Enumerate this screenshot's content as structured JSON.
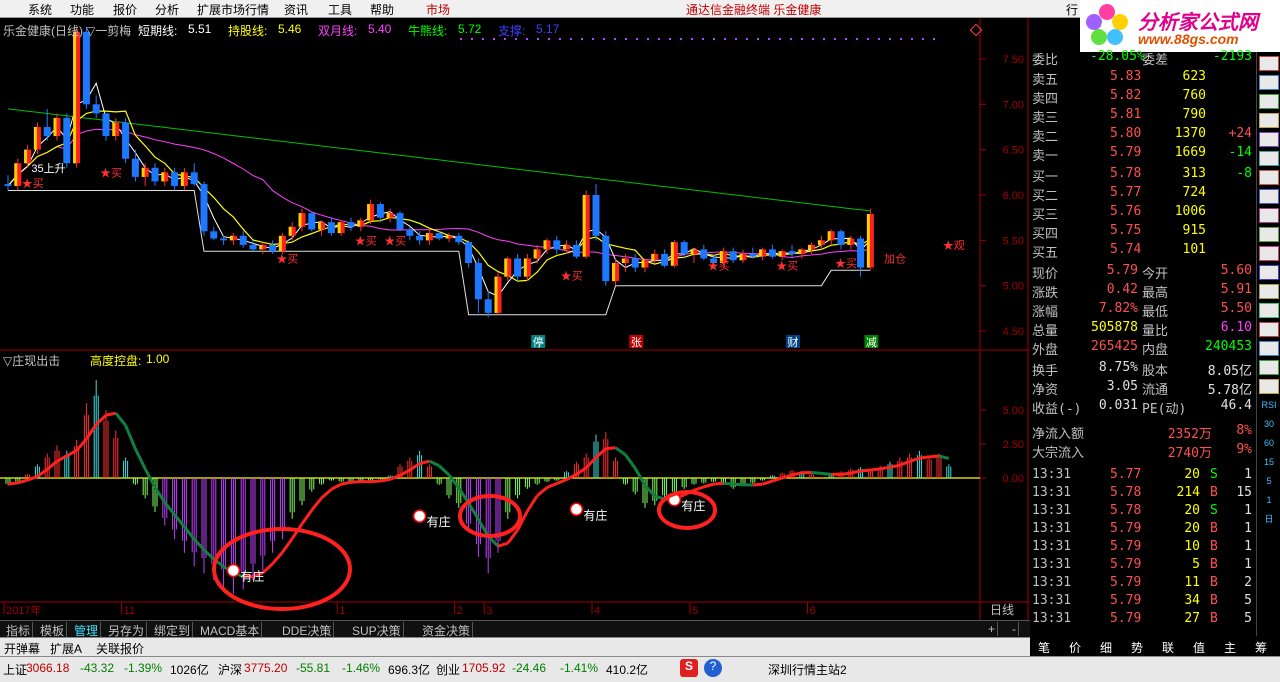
{
  "menu": [
    "系统",
    "功能",
    "报价",
    "分析",
    "扩展市场行情",
    "资讯",
    "工具",
    "帮助",
    "市场"
  ],
  "center_title": "通达信金融终端  乐金健康",
  "right_menu": "行",
  "logo": {
    "text1": "分析家公式网",
    "text2": "www.88gs.com"
  },
  "chart_header": {
    "name": "乐金健康(日线)",
    "indicator": "▽一剪梅",
    "items": [
      {
        "label": "短期线:",
        "value": "5.51",
        "color": "#ffffff"
      },
      {
        "label": "持股线:",
        "value": "5.46",
        "color": "#ffff00"
      },
      {
        "label": "双月线:",
        "value": "5.40",
        "color": "#ff40ff"
      },
      {
        "label": "牛熊线:",
        "value": "5.72",
        "color": "#00ff00"
      },
      {
        "label": "支撑:",
        "value": "5.17",
        "color": "#4040ff"
      }
    ]
  },
  "price_axis": [
    "7.50",
    "7.00",
    "6.50",
    "6.00",
    "5.50",
    "5.00",
    "4.50"
  ],
  "candles": [
    [
      6.12,
      6.22,
      6.05,
      6.1
    ],
    [
      6.1,
      6.4,
      6.05,
      6.35
    ],
    [
      6.35,
      6.55,
      6.3,
      6.5
    ],
    [
      6.5,
      6.8,
      6.45,
      6.75
    ],
    [
      6.75,
      6.95,
      6.6,
      6.65
    ],
    [
      6.65,
      6.9,
      6.6,
      6.85
    ],
    [
      6.85,
      6.9,
      6.3,
      6.35
    ],
    [
      6.35,
      7.85,
      6.3,
      7.8
    ],
    [
      7.8,
      7.85,
      6.95,
      7.0
    ],
    [
      7.0,
      7.1,
      6.85,
      6.9
    ],
    [
      6.9,
      6.9,
      6.6,
      6.65
    ],
    [
      6.65,
      6.85,
      6.6,
      6.8
    ],
    [
      6.8,
      6.85,
      6.35,
      6.4
    ],
    [
      6.4,
      6.5,
      6.15,
      6.2
    ],
    [
      6.2,
      6.35,
      6.1,
      6.3
    ],
    [
      6.3,
      6.35,
      6.1,
      6.15
    ],
    [
      6.15,
      6.3,
      6.1,
      6.25
    ],
    [
      6.25,
      6.3,
      6.05,
      6.1
    ],
    [
      6.1,
      6.3,
      6.05,
      6.25
    ],
    [
      6.25,
      6.35,
      6.1,
      6.12
    ],
    [
      6.12,
      6.15,
      5.55,
      5.6
    ],
    [
      5.6,
      5.65,
      5.5,
      5.52
    ],
    [
      5.52,
      5.55,
      5.45,
      5.5
    ],
    [
      5.5,
      5.58,
      5.45,
      5.55
    ],
    [
      5.55,
      5.6,
      5.42,
      5.45
    ],
    [
      5.45,
      5.5,
      5.38,
      5.4
    ],
    [
      5.4,
      5.48,
      5.35,
      5.45
    ],
    [
      5.45,
      5.5,
      5.35,
      5.38
    ],
    [
      5.38,
      5.58,
      5.35,
      5.55
    ],
    [
      5.55,
      5.7,
      5.5,
      5.65
    ],
    [
      5.65,
      5.85,
      5.6,
      5.8
    ],
    [
      5.8,
      5.82,
      5.6,
      5.62
    ],
    [
      5.62,
      5.72,
      5.55,
      5.7
    ],
    [
      5.7,
      5.75,
      5.55,
      5.58
    ],
    [
      5.58,
      5.72,
      5.55,
      5.7
    ],
    [
      5.7,
      5.75,
      5.6,
      5.65
    ],
    [
      5.65,
      5.75,
      5.6,
      5.72
    ],
    [
      5.72,
      5.95,
      5.68,
      5.9
    ],
    [
      5.9,
      5.92,
      5.7,
      5.75
    ],
    [
      5.75,
      5.85,
      5.7,
      5.8
    ],
    [
      5.8,
      5.82,
      5.6,
      5.62
    ],
    [
      5.62,
      5.65,
      5.5,
      5.55
    ],
    [
      5.55,
      5.6,
      5.45,
      5.5
    ],
    [
      5.5,
      5.62,
      5.45,
      5.58
    ],
    [
      5.58,
      5.6,
      5.5,
      5.52
    ],
    [
      5.52,
      5.58,
      5.48,
      5.55
    ],
    [
      5.55,
      5.58,
      5.45,
      5.48
    ],
    [
      5.48,
      5.5,
      5.2,
      5.25
    ],
    [
      5.25,
      5.3,
      4.7,
      4.85
    ],
    [
      4.85,
      4.95,
      4.65,
      4.7
    ],
    [
      4.7,
      5.15,
      4.68,
      5.1
    ],
    [
      5.1,
      5.32,
      5.05,
      5.3
    ],
    [
      5.3,
      5.35,
      5.05,
      5.1
    ],
    [
      5.1,
      5.35,
      5.05,
      5.3
    ],
    [
      5.3,
      5.45,
      5.25,
      5.4
    ],
    [
      5.4,
      5.52,
      5.35,
      5.5
    ],
    [
      5.5,
      5.55,
      5.35,
      5.4
    ],
    [
      5.4,
      5.5,
      5.35,
      5.45
    ],
    [
      5.45,
      5.5,
      5.3,
      5.32
    ],
    [
      5.32,
      6.05,
      5.3,
      6.0
    ],
    [
      6.0,
      6.12,
      5.5,
      5.55
    ],
    [
      5.55,
      5.6,
      5.0,
      5.05
    ],
    [
      5.05,
      5.3,
      5.0,
      5.25
    ],
    [
      5.25,
      5.35,
      5.15,
      5.3
    ],
    [
      5.3,
      5.35,
      5.15,
      5.2
    ],
    [
      5.2,
      5.3,
      5.15,
      5.28
    ],
    [
      5.28,
      5.4,
      5.25,
      5.35
    ],
    [
      5.35,
      5.4,
      5.2,
      5.22
    ],
    [
      5.22,
      5.5,
      5.2,
      5.48
    ],
    [
      5.48,
      5.5,
      5.3,
      5.35
    ],
    [
      5.35,
      5.42,
      5.25,
      5.4
    ],
    [
      5.4,
      5.45,
      5.28,
      5.3
    ],
    [
      5.3,
      5.35,
      5.2,
      5.25
    ],
    [
      5.25,
      5.42,
      5.22,
      5.38
    ],
    [
      5.38,
      5.42,
      5.25,
      5.28
    ],
    [
      5.28,
      5.4,
      5.25,
      5.35
    ],
    [
      5.35,
      5.42,
      5.3,
      5.32
    ],
    [
      5.32,
      5.42,
      5.28,
      5.4
    ],
    [
      5.4,
      5.45,
      5.3,
      5.32
    ],
    [
      5.32,
      5.4,
      5.28,
      5.38
    ],
    [
      5.38,
      5.45,
      5.3,
      5.35
    ],
    [
      5.35,
      5.42,
      5.3,
      5.4
    ],
    [
      5.4,
      5.48,
      5.35,
      5.45
    ],
    [
      5.45,
      5.55,
      5.4,
      5.5
    ],
    [
      5.5,
      5.62,
      5.45,
      5.6
    ],
    [
      5.6,
      5.62,
      5.4,
      5.45
    ],
    [
      5.45,
      5.55,
      5.4,
      5.52
    ],
    [
      5.52,
      5.55,
      5.1,
      5.2
    ],
    [
      5.2,
      5.85,
      5.18,
      5.79
    ]
  ],
  "ma_note": "",
  "price_annotations": [
    {
      "text": "35上升",
      "color": "#ffffff",
      "bar": 3,
      "price": 6.3
    },
    {
      "text": "★买",
      "color": "#ff3030",
      "bar": 2,
      "price": 6.13
    },
    {
      "text": "★买",
      "color": "#ff3030",
      "bar": 10,
      "price": 6.25
    },
    {
      "text": "★买",
      "color": "#ff3030",
      "bar": 36,
      "price": 5.5
    },
    {
      "text": "★买",
      "color": "#ff3030",
      "bar": 39,
      "price": 5.5
    },
    {
      "text": "★买",
      "color": "#ff3030",
      "bar": 28,
      "price": 5.3
    },
    {
      "text": "★买",
      "color": "#ff3030",
      "bar": 57,
      "price": 5.11
    },
    {
      "text": "★买",
      "color": "#ff3030",
      "bar": 72,
      "price": 5.22
    },
    {
      "text": "★买",
      "color": "#ff3030",
      "bar": 79,
      "price": 5.22
    },
    {
      "text": "★买",
      "color": "#ff3030",
      "bar": 85,
      "price": 5.25
    },
    {
      "text": "加仓",
      "color": "#ff3030",
      "bar": 90,
      "price": 5.3
    },
    {
      "text": "★观",
      "color": "#ff3030",
      "bar": 96,
      "price": 5.45
    }
  ],
  "event_tags": [
    {
      "text": "停",
      "bg": "#008080",
      "bar": 54
    },
    {
      "text": "张",
      "bg": "#c00000",
      "bar": 64
    },
    {
      "text": "财",
      "bg": "#004080",
      "bar": 80
    },
    {
      "text": "减",
      "bg": "#008000",
      "bar": 88
    }
  ],
  "lower_header": {
    "title": "▽庄现出击",
    "label": "高度控盘:",
    "value": "1.00"
  },
  "lower_axis": [
    "5.00",
    "2.50",
    "0.00"
  ],
  "osc": [
    -0.5,
    -0.3,
    0.3,
    1.0,
    1.8,
    2.4,
    2.0,
    2.8,
    5.5,
    7.2,
    5.0,
    3.5,
    1.5,
    -0.5,
    -1.5,
    -2.5,
    -3.5,
    -4.5,
    -5.5,
    -6.5,
    -7.0,
    -7.5,
    -8.0,
    -8.5,
    -8.2,
    -7.5,
    -6.8,
    -5.5,
    -4.5,
    -3.0,
    -2.0,
    -1.0,
    -0.5,
    -0.2,
    -0.3,
    -0.4,
    -0.3,
    -0.2,
    -0.1,
    0.2,
    1.0,
    1.5,
    2.0,
    1.0,
    -0.5,
    -1.5,
    -2.2,
    -4.0,
    -5.8,
    -7.0,
    -5.5,
    -3.0,
    -1.5,
    -0.8,
    -0.5,
    -0.3,
    -0.2,
    0.5,
    1.2,
    1.8,
    3.2,
    3.4,
    1.5,
    -0.5,
    -1.2,
    -2.2,
    -2.0,
    -1.5,
    -1.2,
    -0.8,
    -0.5,
    -0.4,
    -0.3,
    -0.5,
    -0.8,
    -0.6,
    -0.4,
    -0.2,
    0.2,
    0.4,
    0.6,
    0.5,
    0.3,
    0.1,
    0.3,
    0.5,
    0.7,
    0.8,
    0.6,
    0.9,
    1.2,
    1.5,
    1.8,
    2.0,
    1.6,
    1.8,
    1.0
  ],
  "zhuang_tags": [
    {
      "text": "有庄",
      "bar": 23,
      "value": -6.8
    },
    {
      "text": "有庄",
      "bar": 42,
      "value": -2.8
    },
    {
      "text": "有庄",
      "bar": 58,
      "value": -2.3
    },
    {
      "text": "有庄",
      "bar": 68,
      "value": -1.6
    }
  ],
  "date_axis": [
    {
      "text": "2017年",
      "bar": 0
    },
    {
      "text": "11",
      "bar": 12
    },
    {
      "text": "1",
      "bar": 34
    },
    {
      "text": "2",
      "bar": 46
    },
    {
      "text": "3",
      "bar": 49
    },
    {
      "text": "4",
      "bar": 60
    },
    {
      "text": "5",
      "bar": 70
    },
    {
      "text": "6",
      "bar": 82
    }
  ],
  "period": "日线",
  "tabs": [
    "指标",
    "模板",
    "管理",
    "另存为",
    "绑定到",
    "MACD基本",
    "DDE决策",
    "SUP决策",
    "资金决策"
  ],
  "active_tab": "管理",
  "tabs2": [
    "开弹幕",
    "扩展A",
    "关联报价"
  ],
  "quote": {
    "weibi": {
      "label": "委比",
      "value": "-28.05%",
      "label2": "委差",
      "value2": "-2193"
    },
    "sell": [
      {
        "label": "卖五",
        "price": "5.83",
        "vol": "623",
        "chg": ""
      },
      {
        "label": "卖四",
        "price": "5.82",
        "vol": "760",
        "chg": ""
      },
      {
        "label": "卖三",
        "price": "5.81",
        "vol": "790",
        "chg": ""
      },
      {
        "label": "卖二",
        "price": "5.80",
        "vol": "1370",
        "chg": "+24"
      },
      {
        "label": "卖一",
        "price": "5.79",
        "vol": "1669",
        "chg": "-14"
      }
    ],
    "buy": [
      {
        "label": "买一",
        "price": "5.78",
        "vol": "313",
        "chg": "-8"
      },
      {
        "label": "买二",
        "price": "5.77",
        "vol": "724",
        "chg": ""
      },
      {
        "label": "买三",
        "price": "5.76",
        "vol": "1006",
        "chg": ""
      },
      {
        "label": "买四",
        "price": "5.75",
        "vol": "915",
        "chg": ""
      },
      {
        "label": "买五",
        "price": "5.74",
        "vol": "101",
        "chg": ""
      }
    ],
    "stats": [
      {
        "l1": "现价",
        "v1": "5.79",
        "c1": "#ff5050",
        "l2": "今开",
        "v2": "5.60",
        "c2": "#ff5050"
      },
      {
        "l1": "涨跌",
        "v1": "0.42",
        "c1": "#ff5050",
        "l2": "最高",
        "v2": "5.91",
        "c2": "#ff5050"
      },
      {
        "l1": "涨幅",
        "v1": "7.82%",
        "c1": "#ff5050",
        "l2": "最低",
        "v2": "5.50",
        "c2": "#ff5050"
      },
      {
        "l1": "总量",
        "v1": "505878",
        "c1": "#ffff00",
        "l2": "量比",
        "v2": "6.10",
        "c2": "#ff40ff"
      },
      {
        "l1": "外盘",
        "v1": "265425",
        "c1": "#ff5050",
        "l2": "内盘",
        "v2": "240453",
        "c2": "#00ff00"
      }
    ],
    "stats2": [
      {
        "l1": "换手",
        "v1": "8.75%",
        "l2": "股本",
        "v2": "8.05亿"
      },
      {
        "l1": "净资",
        "v1": "3.05",
        "l2": "流通",
        "v2": "5.78亿"
      },
      {
        "l1": "收益(-)",
        "v1": "0.031",
        "l2": "PE(动)",
        "v2": "46.4"
      }
    ],
    "flow": [
      {
        "label": "净流入额",
        "value": "2352万",
        "pct": "8%"
      },
      {
        "label": "大宗流入",
        "value": "2740万",
        "pct": "9%"
      }
    ],
    "ticks": [
      {
        "t": "13:31",
        "p": "5.77",
        "v": "20",
        "s": "S",
        "n": "1"
      },
      {
        "t": "13:31",
        "p": "5.78",
        "v": "214",
        "s": "B",
        "n": "15"
      },
      {
        "t": "13:31",
        "p": "5.78",
        "v": "20",
        "s": "S",
        "n": "1"
      },
      {
        "t": "13:31",
        "p": "5.79",
        "v": "20",
        "s": "B",
        "n": "1"
      },
      {
        "t": "13:31",
        "p": "5.79",
        "v": "10",
        "s": "B",
        "n": "1"
      },
      {
        "t": "13:31",
        "p": "5.79",
        "v": "5",
        "s": "B",
        "n": "1"
      },
      {
        "t": "13:31",
        "p": "5.79",
        "v": "11",
        "s": "B",
        "n": "2"
      },
      {
        "t": "13:31",
        "p": "5.79",
        "v": "34",
        "s": "B",
        "n": "5"
      },
      {
        "t": "13:31",
        "p": "5.79",
        "v": "27",
        "s": "B",
        "n": "5"
      }
    ]
  },
  "bottom_tabs": [
    "笔",
    "价",
    "细",
    "势",
    "联",
    "值",
    "主",
    "筹"
  ],
  "icon_side": [
    "RSI",
    "30",
    "60",
    "15",
    "5",
    "1",
    "日"
  ],
  "status": {
    "sh_label": "上证",
    "sh_val": "3066.18",
    "sh_chg": "-43.32",
    "sh_pct": "-1.39%",
    "sh_amt": "1026亿",
    "sz_label": "沪深",
    "sz_val": "3775.20",
    "sz_chg": "-55.81",
    "sz_pct": "-1.46%",
    "sz_amt": "696.3亿",
    "cy_label": "创业",
    "cy_val": "1705.92",
    "cy_chg": "-24.46",
    "cy_pct": "-1.41%",
    "cy_amt": "410.2亿",
    "server": "深圳行情主站2"
  }
}
